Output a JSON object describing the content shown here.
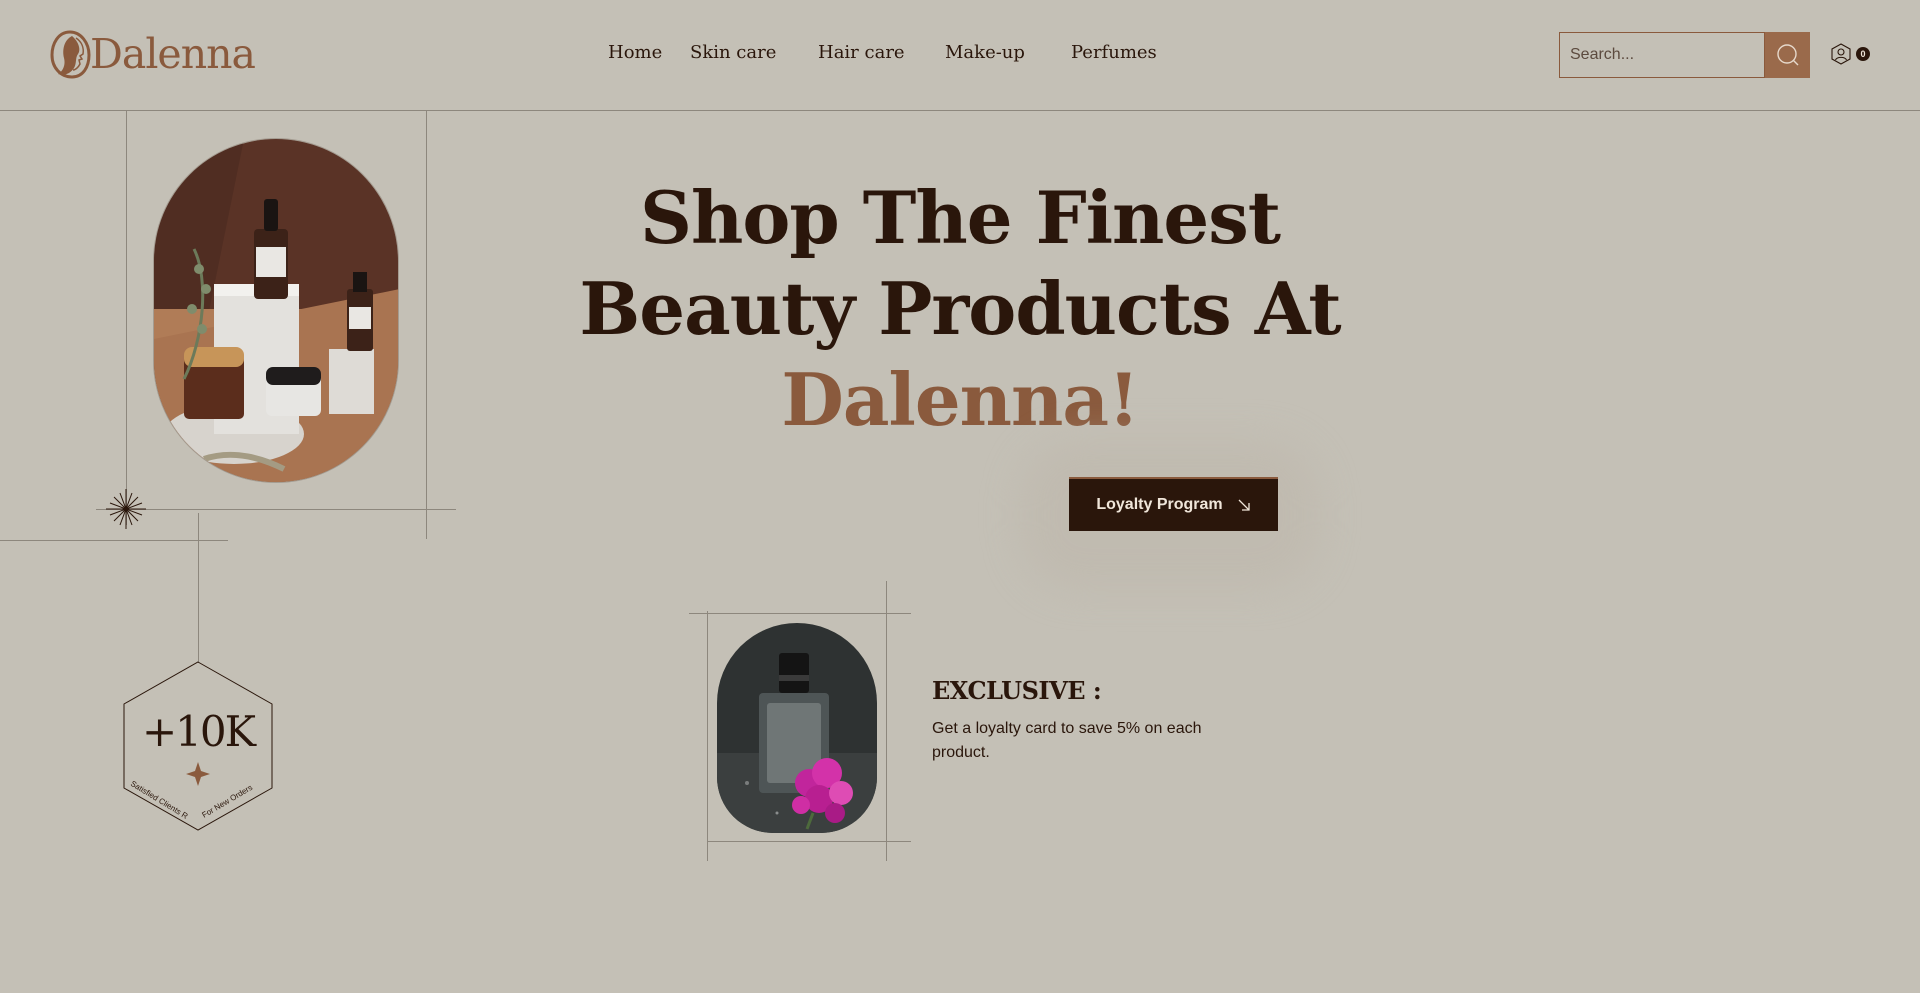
{
  "brand": {
    "name": "Dalenna",
    "accent_color": "#8a5a3d",
    "dark_color": "#2a160b",
    "background": "#c4c0b6"
  },
  "nav": {
    "items": [
      {
        "label": "Home"
      },
      {
        "label": "Skin care"
      },
      {
        "label": "Hair care"
      },
      {
        "label": "Make-up"
      },
      {
        "label": "Perfumes"
      }
    ]
  },
  "search": {
    "placeholder": "Search...",
    "icon": "search-icon"
  },
  "user": {
    "icon": "user-icon",
    "cart_count": "0"
  },
  "hero": {
    "title_line1": "Shop The Finest",
    "title_line2": "Beauty Products At",
    "title_accent": "Dalenna!",
    "cta_label": "Loyalty Program",
    "cta_icon": "arrow-down-right-icon"
  },
  "exclusive": {
    "title": "EXCLUSIVE :",
    "text": "Get a loyalty card to save 5% on each product."
  },
  "stats": {
    "value": "+10K",
    "label_left": "Satisfied Clients Return",
    "label_right": "For New Orders"
  }
}
